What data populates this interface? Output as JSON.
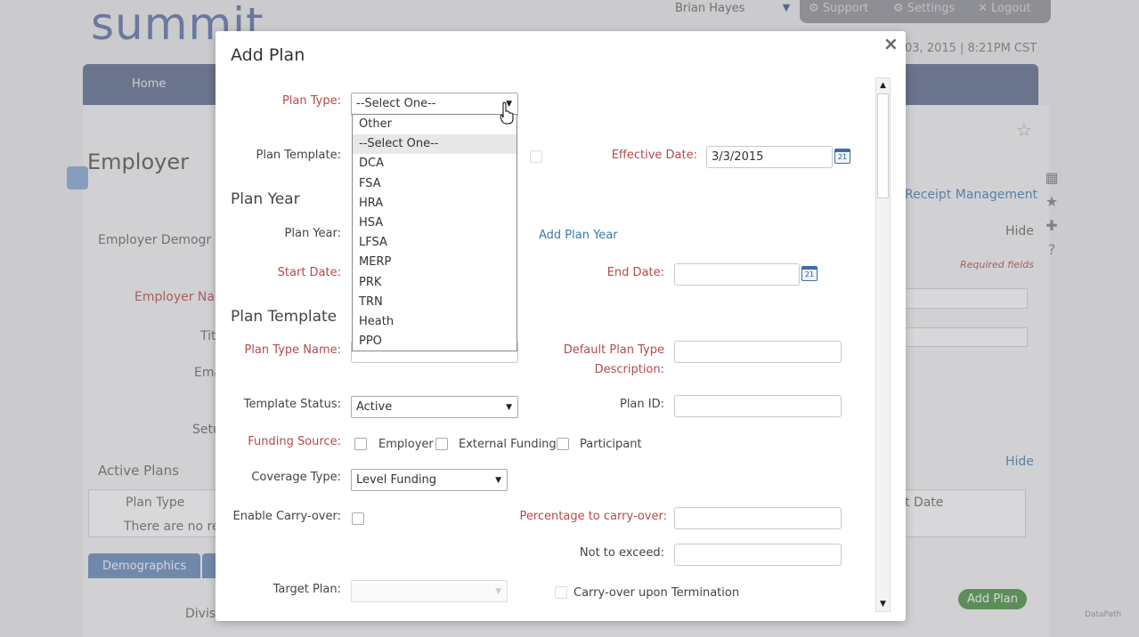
{
  "background": {
    "logo": "summit",
    "user": "Brian Hayes",
    "support": "Support",
    "settings": "Settings",
    "logout": "Logout",
    "datetime": "03, 2015 | 8:21PM CST",
    "nav_home": "Home",
    "page_title": "Employer",
    "employer_demog": "Employer Demogr",
    "hide1": "Hide",
    "receipt_mgmt": "Receipt Management",
    "required_fields": "Required fields",
    "employer_name": "Employer Nam",
    "title": "Titl",
    "email": "Ema",
    "setup": "Setu",
    "active_plans": "Active Plans",
    "hide2": "Hide",
    "plan_type_col": "Plan Type",
    "no_records": "There are no rec",
    "end_date_col": "t Date",
    "tab_demographics": "Demographics",
    "division": "Divis",
    "add_plan_btn": "Add Plan",
    "watermark": "DataPath"
  },
  "modal": {
    "title": "Add Plan",
    "close": "×",
    "plan_type_label": "Plan Type:",
    "plan_type_value": "--Select One--",
    "plan_type_options": [
      "Other",
      "--Select One--",
      "DCA",
      "FSA",
      "HRA",
      "HSA",
      "LFSA",
      "MERP",
      "PRK",
      "TRN",
      "Heath",
      "PPO"
    ],
    "plan_template_label": "Plan Template:",
    "effective_date_label": "Effective Date:",
    "effective_date_value": "3/3/2015",
    "calendar_icon_text": "21",
    "plan_year_section": "Plan Year",
    "plan_year_label": "Plan Year:",
    "add_plan_year_link": "Add Plan Year",
    "start_date_label": "Start Date:",
    "end_date_label": "End Date:",
    "plan_template_section": "Plan Template",
    "plan_type_name_label": "Plan Type Name:",
    "default_desc_label_1": "Default Plan Type",
    "default_desc_label_2": "Description:",
    "template_status_label": "Template Status:",
    "template_status_value": "Active",
    "plan_id_label": "Plan ID:",
    "funding_source_label": "Funding Source:",
    "funding_employer": "Employer",
    "funding_external": "External Funding",
    "funding_participant": "Participant",
    "coverage_type_label": "Coverage Type:",
    "coverage_type_value": "Level Funding",
    "enable_carryover_label": "Enable Carry-over:",
    "pct_carryover_label": "Percentage to carry-over:",
    "not_to_exceed_label": "Not to exceed:",
    "target_plan_label": "Target Plan:",
    "carryover_termination_label": "Carry-over upon Termination"
  },
  "colors": {
    "required_label": "#b44a4a",
    "link": "#3a7aa8",
    "nav": "#6f7a98",
    "add_plan_green": "#5e9a5a"
  }
}
